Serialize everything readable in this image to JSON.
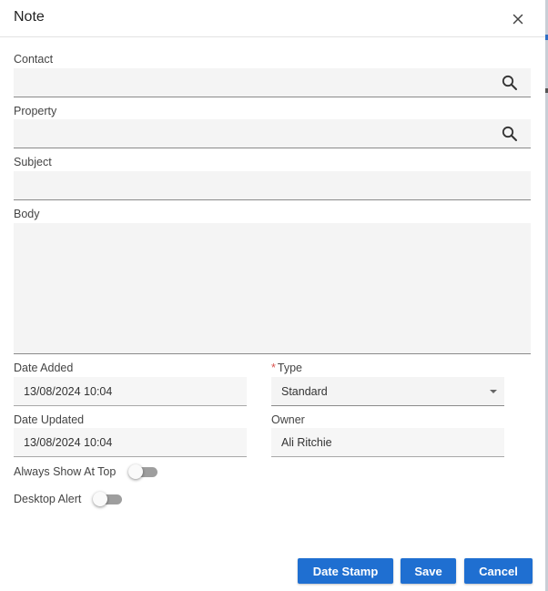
{
  "dialog": {
    "title": "Note"
  },
  "fields": {
    "contact": {
      "label": "Contact",
      "value": ""
    },
    "property": {
      "label": "Property",
      "value": ""
    },
    "subject": {
      "label": "Subject",
      "value": ""
    },
    "body": {
      "label": "Body",
      "value": ""
    },
    "date_added": {
      "label": "Date Added",
      "value": "13/08/2024 10:04"
    },
    "type": {
      "label": "Type",
      "required_mark": "*",
      "value": "Standard"
    },
    "date_updated": {
      "label": "Date Updated",
      "value": "13/08/2024 10:04"
    },
    "owner": {
      "label": "Owner",
      "value": "Ali Ritchie"
    }
  },
  "toggles": {
    "always_show_at_top": {
      "label": "Always Show At Top",
      "on": false
    },
    "desktop_alert": {
      "label": "Desktop Alert",
      "on": false
    }
  },
  "buttons": {
    "date_stamp": "Date Stamp",
    "save": "Save",
    "cancel": "Cancel"
  },
  "colors": {
    "primary": "#1f6fd1",
    "required": "#d9534f",
    "field_bg": "#f4f4f4"
  }
}
